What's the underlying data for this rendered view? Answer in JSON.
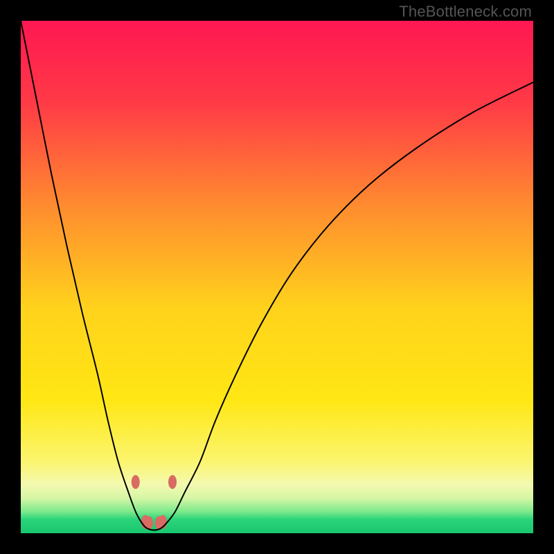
{
  "watermark": "TheBottleneck.com",
  "chart_data": {
    "type": "line",
    "title": "",
    "xlabel": "",
    "ylabel": "",
    "xlim": [
      0,
      100
    ],
    "ylim": [
      0,
      100
    ],
    "background_gradient": {
      "orientation": "vertical",
      "stops": [
        {
          "pct": 0,
          "color": "#ff1752"
        },
        {
          "pct": 16,
          "color": "#ff3a46"
        },
        {
          "pct": 36,
          "color": "#ff8b2f"
        },
        {
          "pct": 56,
          "color": "#ffd21c"
        },
        {
          "pct": 74,
          "color": "#ffe714"
        },
        {
          "pct": 86,
          "color": "#fbf56f"
        },
        {
          "pct": 90.5,
          "color": "#f4f9b0"
        },
        {
          "pct": 93.2,
          "color": "#d4f6a4"
        },
        {
          "pct": 95.8,
          "color": "#7ce98c"
        },
        {
          "pct": 97.3,
          "color": "#2bd47a"
        },
        {
          "pct": 100,
          "color": "#18c66f"
        }
      ]
    },
    "series": [
      {
        "name": "bottleneck-curve",
        "color": "#000000",
        "stroke_width": 2,
        "x": [
          0,
          3,
          6,
          9,
          12,
          15,
          17,
          19,
          21,
          22.5,
          24,
          25,
          26,
          27,
          28,
          30,
          32,
          35,
          38,
          42,
          47,
          53,
          60,
          68,
          77,
          88,
          100
        ],
        "y": [
          100,
          85,
          70,
          56,
          43,
          31,
          22,
          14,
          8,
          4,
          1.5,
          0.8,
          0.6,
          0.8,
          1.5,
          4,
          8,
          14,
          22,
          31,
          41,
          51,
          60,
          68,
          75,
          82,
          88
        ]
      }
    ],
    "markers": {
      "name": "bottleneck-markers",
      "color": "#d96b63",
      "x": [
        22.4,
        24.3,
        25.0,
        27.0,
        27.7,
        29.6
      ],
      "y": [
        10.0,
        2.2,
        2.0,
        2.0,
        2.2,
        10.0
      ],
      "rx": 6,
      "ry": 10
    }
  }
}
